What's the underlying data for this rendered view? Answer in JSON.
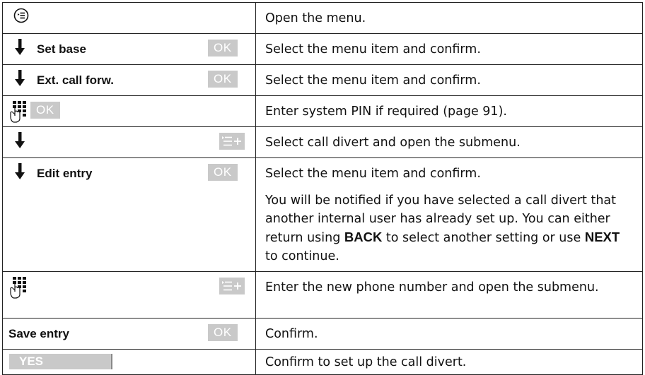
{
  "rows": [
    {
      "key_icon": "menu-key-icon",
      "text": "Open the menu."
    },
    {
      "key_icon": "down-arrow-icon",
      "label": "Set base",
      "softkey": "OK",
      "text": "Select the menu item and confirm."
    },
    {
      "key_icon": "down-arrow-icon",
      "label": "Ext. call forw.",
      "softkey": "OK",
      "text": "Select the menu item and confirm."
    },
    {
      "key_icon": "keypad-icon",
      "softkey": "OK",
      "text": "Enter system PIN if required (page 91)."
    },
    {
      "key_icon": "down-arrow-icon",
      "softkey_icon": "submenu-key-icon",
      "text": "Select call divert and open the submenu."
    },
    {
      "key_icon": "down-arrow-icon",
      "label": "Edit entry",
      "softkey": "OK",
      "text": "Select the menu item and confirm.",
      "note": {
        "p1": "You will be notified if you have selected a call divert that another internal user has already set up. You can either return using ",
        "back": "BACK",
        "p2": " to select another setting or use ",
        "next": "NEXT",
        "p3": " to continue."
      }
    },
    {
      "key_icon": "keypad-icon",
      "softkey_icon": "submenu-key-icon",
      "text": "Enter the new phone number and open the submenu."
    },
    {
      "label": "Save entry",
      "softkey": "OK",
      "text": "Confirm."
    },
    {
      "softkey": "YES",
      "text": "Confirm to set up the call divert."
    }
  ]
}
